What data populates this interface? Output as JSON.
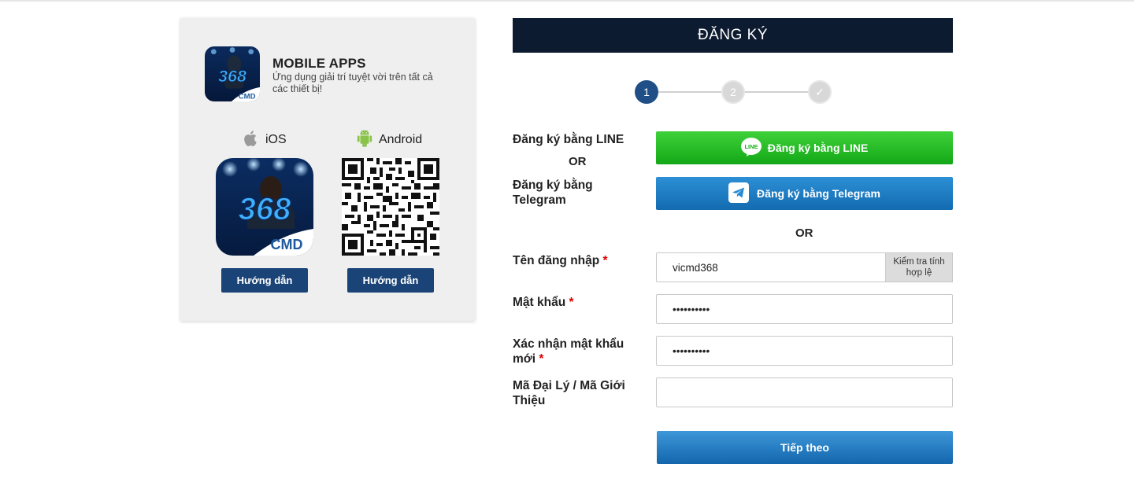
{
  "mobile_apps": {
    "title": "MOBILE APPS",
    "subtitle": "Ứng dụng giải trí tuyệt vời trên tất cả các thiết bị!",
    "ios_label": "iOS",
    "android_label": "Android",
    "guide_ios": "Hướng dẫn",
    "guide_android": "Hướng dẫn",
    "logo_number": "368",
    "logo_brand": "CMD"
  },
  "form": {
    "title": "ĐĂNG KÝ",
    "steps": [
      "1",
      "2",
      "✓"
    ],
    "line_label": "Đăng ký bằng LINE",
    "or_1": "OR",
    "telegram_label": "Đăng ký bằng Telegram",
    "line_button": "Đăng ký bằng LINE",
    "line_icon_text": "LINE",
    "telegram_button": "Đăng ký bằng Telegram",
    "or_2": "OR",
    "username_label": "Tên đăng nhập",
    "username_value": "vicmd368",
    "check_button": "Kiểm tra tính hợp lệ",
    "password_label": "Mật khẩu",
    "password_value": "••••••••••",
    "confirm_label": "Xác nhận mật khẩu mới",
    "confirm_value": "••••••••••",
    "agent_label": "Mã Đại Lý / Mã Giới Thiệu",
    "agent_value": "",
    "required_mark": "*",
    "next_button": "Tiếp theo"
  },
  "colors": {
    "header_bg": "#0d1b30",
    "guide_btn": "#1a4477",
    "line_green": "#13a817",
    "telegram_blue": "#136bb0",
    "step_active": "#1f4f86"
  }
}
